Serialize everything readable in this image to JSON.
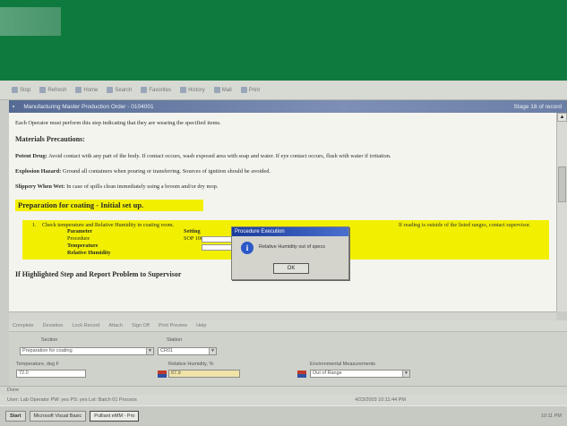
{
  "toolbar": {
    "items": [
      "Stop",
      "Refresh",
      "Home",
      "Search",
      "Favorites",
      "History",
      "Mail",
      "Print"
    ]
  },
  "doc": {
    "title": "Manufacturing Master Production Order - 0104001",
    "right": "Stage 18 of record"
  },
  "content": {
    "intro": "Each Operator must perform this step indicating that they are wearing the specified items.",
    "materials_heading": "Materials Precautions:",
    "potent_label": "Potent Drug:",
    "potent_text": "Avoid contact with any part of the body. If contact occurs, wash exposed area with soap and water. If eye contact occurs, flush with water if irritation.",
    "explosion_label": "Explosion Hazard:",
    "explosion_text": "Ground all containers when pouring or transferring. Sources of ignition should be avoided.",
    "slippery_label": "Slippery When Wet:",
    "slippery_text": "In case of spills clean immediately using a broom and/or dry mop.",
    "prep_heading": "Preparation for coating - Initial set up.",
    "step_num": "1.",
    "step_text": "Check temperature and Relative Humidity in coating room.",
    "step_text_right": "If reading is outside of the listed ranges, contact supervisor.",
    "param_header": "Parameter",
    "setting_header": "Setting",
    "param_1": "Procedure",
    "setting_1": "SOP 100",
    "param_2": "Temperature",
    "param_3": "Relative Humidity",
    "flag_heading": "If Highlighted Step and Report Problem to Supervisor"
  },
  "dialog": {
    "title": "Procedure Execution",
    "message": "Relative Humidity out of specs",
    "ok": "OK",
    "icon": "info-icon"
  },
  "panel_bar": {
    "items": [
      "Complete",
      "Deviation",
      "Lock Record",
      "Attach",
      "Sign Off",
      "Print Preview",
      "Help"
    ]
  },
  "panel": {
    "section_label": "Section",
    "section_value": "Preparation for coating",
    "station_label": "Station",
    "station_value": "CR01",
    "temp_label": "Temperature, deg F",
    "temp_value": "72.0",
    "rh_label": "Relative Humidity, %",
    "rh_value": "67.9",
    "env_label": "Environmental Measurements",
    "env_value": "Out of Range"
  },
  "status": {
    "line1": "Done",
    "line2": "User: Lab Operator   PW: yes   PS: yes   Lot: Batch 01 Process",
    "datetime": "4/23/2003  10:11:44 PM"
  },
  "taskbar": {
    "start": "Start",
    "tasks": [
      "Microsoft Visual Basic",
      "Pulliant eMM - Pro"
    ],
    "tray": "10:11 PM"
  },
  "colors": {
    "brand_green": "#0e7a3e",
    "highlight_yellow": "#f2f000",
    "title_blue": "#566b94"
  }
}
